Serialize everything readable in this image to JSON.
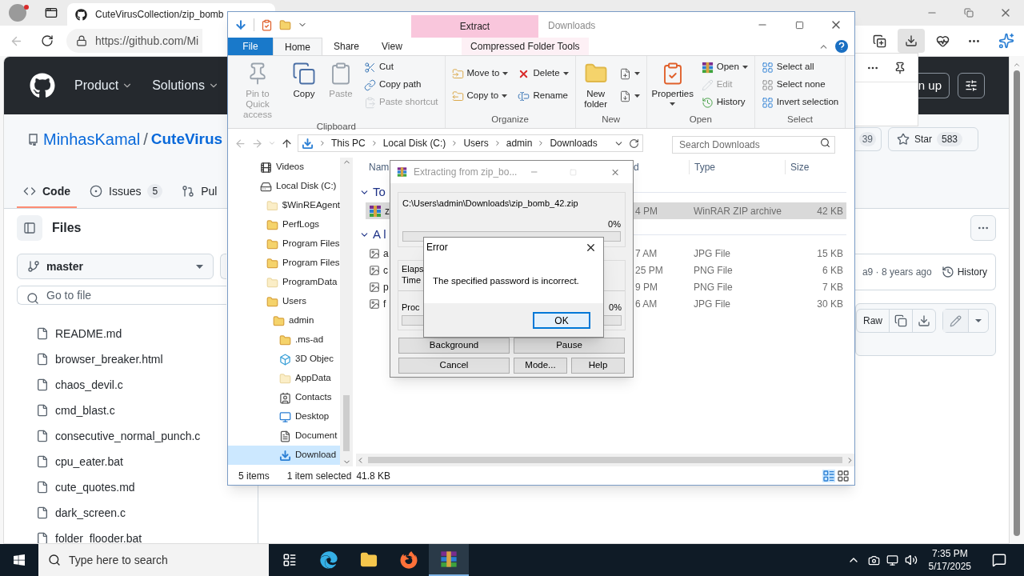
{
  "browser": {
    "tab_title": "CuteVirusCollection/zip_bomb",
    "url": "https://github.com/Mi",
    "page": {
      "nav": [
        "Product",
        "Solutions"
      ],
      "signup": "n up",
      "owner": "MinhasKamal",
      "separator": "/",
      "repo": "CuteVirus",
      "fork_count": "39",
      "star_label": "Star",
      "star_count": "583",
      "tabs": [
        {
          "label": "Code",
          "kind": "code",
          "selected": true
        },
        {
          "label": "Issues",
          "kind": "issues",
          "count": "5",
          "selected": false
        },
        {
          "label": "Pul",
          "kind": "pulls",
          "selected": false
        }
      ],
      "files_title": "Files",
      "branch": "master",
      "search_placeholder": "Go to file",
      "files": [
        "README.md",
        "browser_breaker.html",
        "chaos_devil.c",
        "cmd_blast.c",
        "consecutive_normal_punch.c",
        "cpu_eater.bat",
        "cute_quotes.md",
        "dark_screen.c",
        "folder_flooder.bat"
      ],
      "commit_info": "a9 · 8 years ago",
      "history": "History",
      "raw": "Raw"
    }
  },
  "explorer": {
    "title": "Downloads",
    "context_header": "Extract",
    "ribbon_tabs": [
      {
        "label": "File",
        "kind": "file",
        "selected": false
      },
      {
        "label": "Home",
        "kind": "tab",
        "selected": true
      },
      {
        "label": "Share",
        "kind": "tab",
        "selected": false
      },
      {
        "label": "View",
        "kind": "tab",
        "selected": false
      },
      {
        "label": "Compressed Folder Tools",
        "kind": "contextual",
        "selected": false
      }
    ],
    "groups": [
      {
        "label": "Clipboard",
        "columns": [
          [
            {
              "label": "Pin to Quick access",
              "kind": "pin",
              "disabled": true
            }
          ],
          [
            {
              "label": "Copy",
              "kind": "copy",
              "disabled": false
            }
          ],
          [
            {
              "label": "Paste",
              "kind": "paste",
              "disabled": true
            }
          ],
          [
            {
              "label": "Cut",
              "kind": "cut",
              "disabled": false
            },
            {
              "label": "Copy path",
              "kind": "copy-path",
              "disabled": false
            },
            {
              "label": "Paste shortcut",
              "kind": "paste-shortcut",
              "disabled": true
            }
          ]
        ]
      },
      {
        "label": "Organize",
        "columns": [
          [
            {
              "label": "Move to",
              "kind": "move",
              "dropdown": true,
              "disabled": false
            },
            {
              "label": "Copy to",
              "kind": "copy-to",
              "dropdown": true,
              "disabled": false
            }
          ],
          [
            {
              "label": "Delete",
              "kind": "delete",
              "dropdown": true,
              "disabled": false
            },
            {
              "label": "Rename",
              "kind": "rename",
              "disabled": false
            }
          ]
        ]
      },
      {
        "label": "New",
        "columns": [
          [
            {
              "label": "New folder",
              "kind": "new-folder",
              "disabled": false
            }
          ],
          [
            {
              "kind": "new-item",
              "dropdown": true,
              "disabled": false
            },
            {
              "kind": "easy-access",
              "dropdown": true,
              "disabled": false
            }
          ]
        ]
      },
      {
        "label": "Open",
        "columns": [
          [
            {
              "label": "Properties",
              "kind": "properties",
              "dropdown": true,
              "disabled": false
            }
          ],
          [
            {
              "label": "Open",
              "kind": "open",
              "dropdown": true,
              "disabled": false
            },
            {
              "label": "Edit",
              "kind": "edit",
              "disabled": true
            },
            {
              "label": "History",
              "kind": "history",
              "disabled": false
            }
          ]
        ]
      },
      {
        "label": "Select",
        "columns": [
          [
            {
              "label": "Select all",
              "kind": "select-all",
              "disabled": false
            },
            {
              "label": "Select none",
              "kind": "select-none",
              "disabled": false
            },
            {
              "label": "Invert selection",
              "kind": "invert",
              "disabled": false
            }
          ]
        ]
      }
    ],
    "crumbs": [
      "This PC",
      "Local Disk (C:)",
      "Users",
      "admin",
      "Downloads"
    ],
    "search_placeholder": "Search Downloads",
    "nav": [
      {
        "label": "Videos",
        "kind": "videos",
        "selected": false
      },
      {
        "label": "Local Disk (C:)",
        "kind": "drive",
        "selected": false,
        "children": [
          {
            "label": "$WinREAgent",
            "kind": "hidden-folder",
            "selected": false
          },
          {
            "label": "PerfLogs",
            "kind": "folder",
            "selected": false
          },
          {
            "label": "Program Files",
            "kind": "folder",
            "selected": false
          },
          {
            "label": "Program Files",
            "kind": "folder",
            "selected": false
          },
          {
            "label": "ProgramData",
            "kind": "hidden-folder",
            "selected": false
          },
          {
            "label": "Users",
            "kind": "folder",
            "selected": false,
            "children": [
              {
                "label": "admin",
                "kind": "folder",
                "selected": false,
                "children": [
                  {
                    "label": ".ms-ad",
                    "kind": "folder",
                    "selected": false
                  },
                  {
                    "label": "3D Objec",
                    "kind": "cube",
                    "selected": false
                  },
                  {
                    "label": "AppData",
                    "kind": "hidden-folder",
                    "selected": false
                  },
                  {
                    "label": "Contacts",
                    "kind": "contacts",
                    "selected": false
                  },
                  {
                    "label": "Desktop",
                    "kind": "desktop",
                    "selected": false
                  },
                  {
                    "label": "Document",
                    "kind": "documents",
                    "selected": false
                  },
                  {
                    "label": "Download",
                    "kind": "downloads",
                    "selected": true
                  }
                ]
              }
            ]
          }
        ]
      }
    ],
    "columns": [
      "Nam",
      "d",
      "Type",
      "Size"
    ],
    "file_groups": [
      {
        "label": "To",
        "expanded": true,
        "rows": [
          {
            "name": "z",
            "date": "4 PM",
            "type": "WinRAR ZIP archive",
            "size": "42 KB",
            "kind": "archive",
            "selected": true
          }
        ]
      },
      {
        "label": "A l",
        "expanded": true,
        "rows": [
          {
            "name": "a",
            "date": "7 AM",
            "type": "JPG File",
            "size": "15 KB",
            "kind": "image",
            "selected": false
          },
          {
            "name": "c",
            "date": "25 PM",
            "type": "PNG File",
            "size": "6 KB",
            "kind": "image",
            "selected": false
          },
          {
            "name": "p",
            "date": "9 PM",
            "type": "PNG File",
            "size": "7 KB",
            "kind": "image",
            "selected": false
          },
          {
            "name": "f",
            "date": "6 AM",
            "type": "JPG File",
            "size": "30 KB",
            "kind": "image",
            "selected": false
          }
        ]
      }
    ],
    "status": {
      "items": "5 items",
      "selection": "1 item selected",
      "size": "41.8 KB"
    }
  },
  "extract_dialog": {
    "title": "Extracting from zip_bo...",
    "archive": "C:\\Users\\admin\\Downloads\\zip_bomb_42.zip",
    "progress": {
      "percent": "0%",
      "level": 0
    },
    "elapsed_label": "Elaps",
    "time_label": "Time",
    "processed": {
      "label": "Proc",
      "percent": "0%",
      "level": 0
    },
    "buttons": [
      [
        "Background",
        "Pause"
      ],
      [
        "Cancel",
        "Mode...",
        "Help"
      ]
    ]
  },
  "error_dialog": {
    "title": "Error",
    "message": "The specified password is incorrect.",
    "button": "OK"
  },
  "taskbar": {
    "search_placeholder": "Type here to search",
    "time": "7:35 PM",
    "date": "5/17/2025"
  }
}
